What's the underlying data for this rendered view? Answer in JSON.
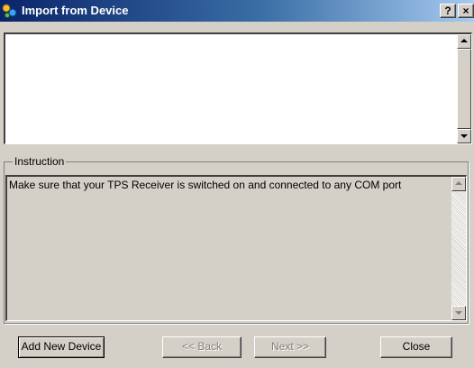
{
  "window": {
    "title": "Import from Device",
    "help_label": "?",
    "close_label": "×"
  },
  "instruction": {
    "group_label": "Instruction",
    "text": "Make sure that your TPS Receiver is switched on and connected to any COM port"
  },
  "buttons": {
    "add_new_device": "Add New Device",
    "back": "<< Back",
    "next": "Next >>",
    "close": "Close"
  },
  "colors": {
    "title_start": "#0a246a",
    "title_end": "#a6caf0",
    "face": "#d4d0c8",
    "disabled_text": "#808080"
  }
}
